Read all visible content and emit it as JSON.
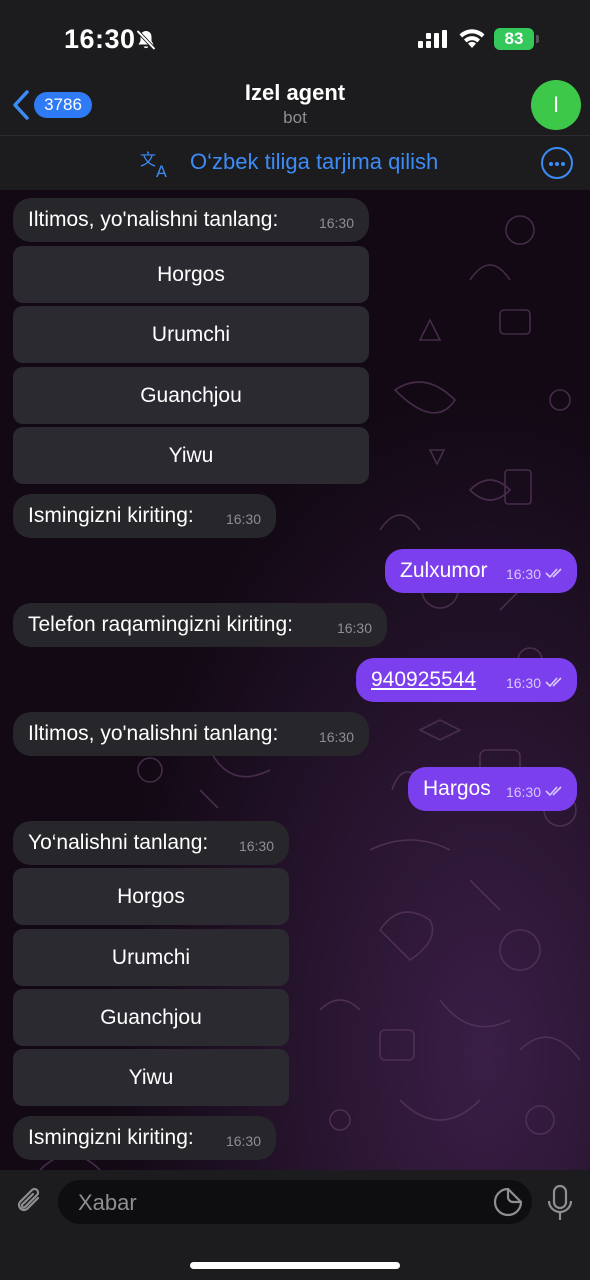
{
  "status_bar": {
    "time": "16:30",
    "battery": "83"
  },
  "header": {
    "unread_count": "3786",
    "title": "Izel agent",
    "subtitle": "bot",
    "avatar_letter": "I"
  },
  "translate_bar": {
    "label": "O‘zbek tiliga tarjima qilish"
  },
  "messages": [
    {
      "text": "Iltimos, yo'nalishni tanlang:",
      "time": "16:30"
    },
    {
      "buttons": [
        "Horgos",
        "Urumchi",
        "Guanchjou",
        "Yiwu"
      ]
    },
    {
      "text": "Ismingizni kiriting:",
      "time": "16:30"
    },
    {
      "text": "Zulxumor",
      "time": "16:30"
    },
    {
      "text": "Telefon raqamingizni kiriting:",
      "time": "16:30"
    },
    {
      "text": "940925544",
      "time": "16:30"
    },
    {
      "text": "Iltimos, yo'nalishni tanlang:",
      "time": "16:30"
    },
    {
      "text": "Hargos",
      "time": "16:30"
    },
    {
      "text": "Yo‘nalishni tanlang:",
      "time": "16:30"
    },
    {
      "buttons": [
        "Horgos",
        "Urumchi",
        "Guanchjou",
        "Yiwu"
      ]
    },
    {
      "text": "Ismingizni kiriting:",
      "time": "16:30"
    }
  ],
  "input": {
    "placeholder": "Xabar",
    "value": ""
  },
  "colors": {
    "accent": "#3b8cf7",
    "outgoing": "#7c3fed",
    "incoming": "#26262b",
    "avatar": "#3ec84a"
  }
}
